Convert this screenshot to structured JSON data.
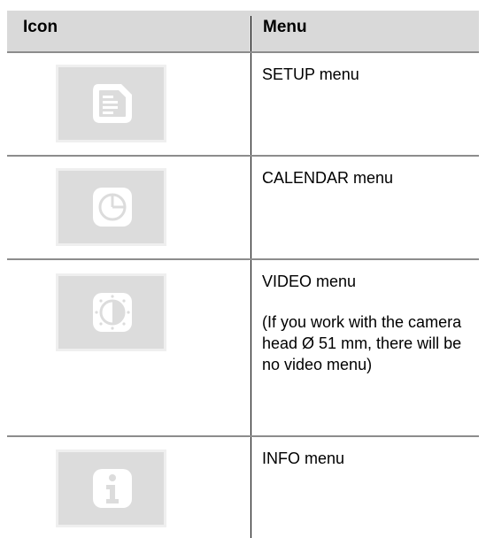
{
  "header": {
    "icon_label": "Icon",
    "menu_label": "Menu"
  },
  "rows": [
    {
      "icon": "setup-document-icon",
      "menu": "SETUP menu"
    },
    {
      "icon": "calendar-clock-icon",
      "menu": "CALENDAR menu"
    },
    {
      "icon": "video-contrast-icon",
      "menu": "VIDEO menu",
      "note": "(If you work with the camera head Ø 51 mm, there will be no video menu)"
    },
    {
      "icon": "info-icon",
      "menu": "INFO menu"
    }
  ]
}
